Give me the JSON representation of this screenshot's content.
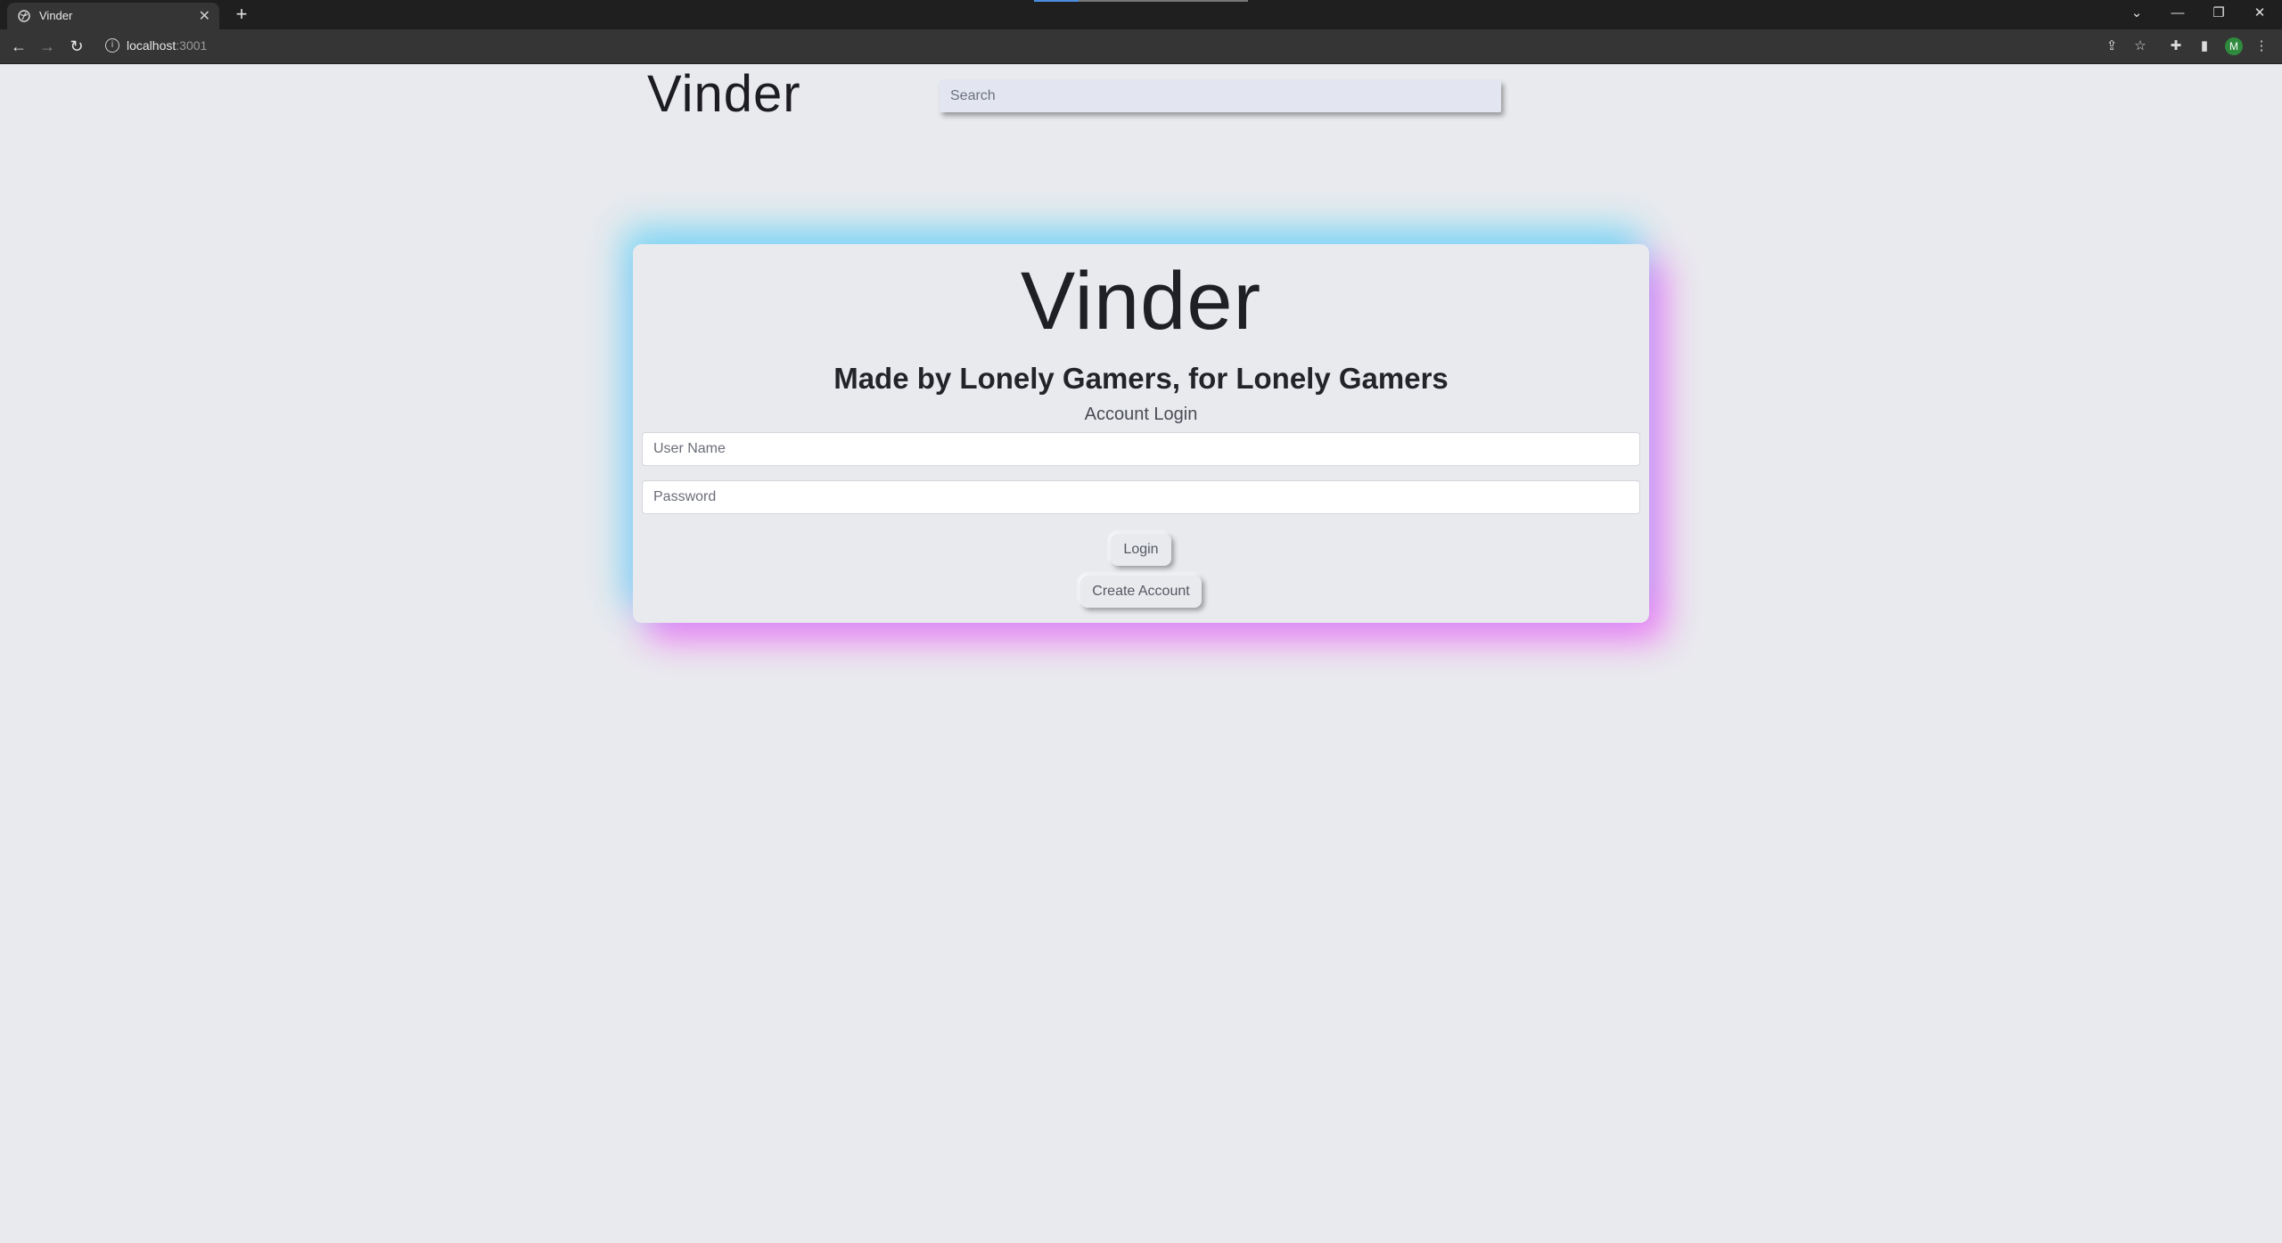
{
  "browser": {
    "tab_title": "Vinder",
    "url_host": "localhost",
    "url_port": ":3001",
    "avatar_letter": "M",
    "icons": {
      "close": "close-icon",
      "new_tab": "plus-icon",
      "back": "arrow-left-icon",
      "forward": "arrow-right-icon",
      "reload": "reload-icon",
      "info": "info-icon",
      "share": "share-icon",
      "bookmark": "star-icon",
      "extensions": "puzzle-icon",
      "side_panel": "side-panel-icon",
      "menu": "kebab-menu-icon",
      "minimize": "minimize-icon",
      "restore": "restore-icon",
      "window_close": "window-close-icon",
      "tab_search": "chevron-down-icon"
    }
  },
  "header": {
    "brand": "Vinder",
    "search_placeholder": "Search"
  },
  "login_card": {
    "title": "Vinder",
    "tagline": "Made by Lonely Gamers, for Lonely Gamers",
    "section_title": "Account Login",
    "username_placeholder": "User Name",
    "password_placeholder": "Password",
    "login_label": "Login",
    "create_account_label": "Create Account"
  },
  "colors": {
    "page_background": "#e9eaee",
    "glow_cyan": "#6ed7f5",
    "glow_magenta": "#f06ef5",
    "avatar_green": "#2f8a3e"
  }
}
